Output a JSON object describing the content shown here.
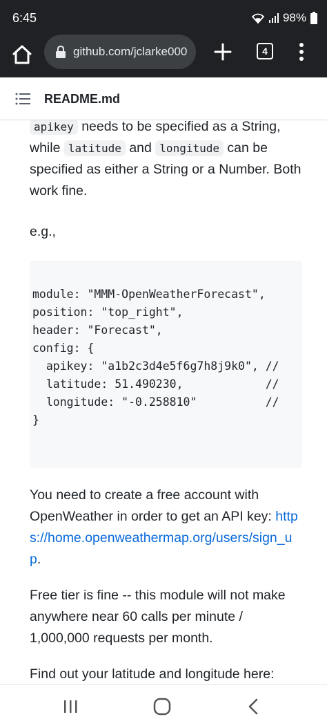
{
  "status_bar": {
    "time": "6:45",
    "battery": "98%",
    "icons": [
      "wifi-icon",
      "signal-icon",
      "battery-icon"
    ]
  },
  "browser": {
    "url": "github.com/jclarke000",
    "tab_count": "4",
    "icons": [
      "home-icon",
      "lock-icon",
      "plus-icon",
      "tabs-icon",
      "more-vert-icon"
    ]
  },
  "readme": {
    "title": "README.md",
    "icon": "list-icon"
  },
  "content": {
    "para1": {
      "code1": "apikey",
      "text1": " needs to be specified as a String, while ",
      "code2": "latitude",
      "text2": " and ",
      "code3": "longitude",
      "text3": " can be specified as either a String or a Number. Both work fine."
    },
    "eg": "e.g.,",
    "code_lines": [
      "module: \"MMM-OpenWeatherForecast\",",
      "position: \"top_right\",",
      "header: \"Forecast\",",
      "config: {",
      "  apikey: \"a1b2c3d4e5f6g7h8j9k0\", //",
      "  latitude: 51.490230,            //",
      "  longitude: \"-0.258810\"          //",
      "}"
    ],
    "para2": {
      "text": "You need to create a free account with OpenWeather in order to get an API key: ",
      "link": "https://home.openweathermap.org/users/sign_up",
      "after": "."
    },
    "para3": "Free tier is fine -- this module will not make anywhere near 60 calls per minute / 1,000,000 requests per month.",
    "para4": "Find out your latitude and longitude here:"
  },
  "nav": {
    "icons": [
      "recent-apps-icon",
      "home-circle-icon",
      "back-icon"
    ]
  }
}
